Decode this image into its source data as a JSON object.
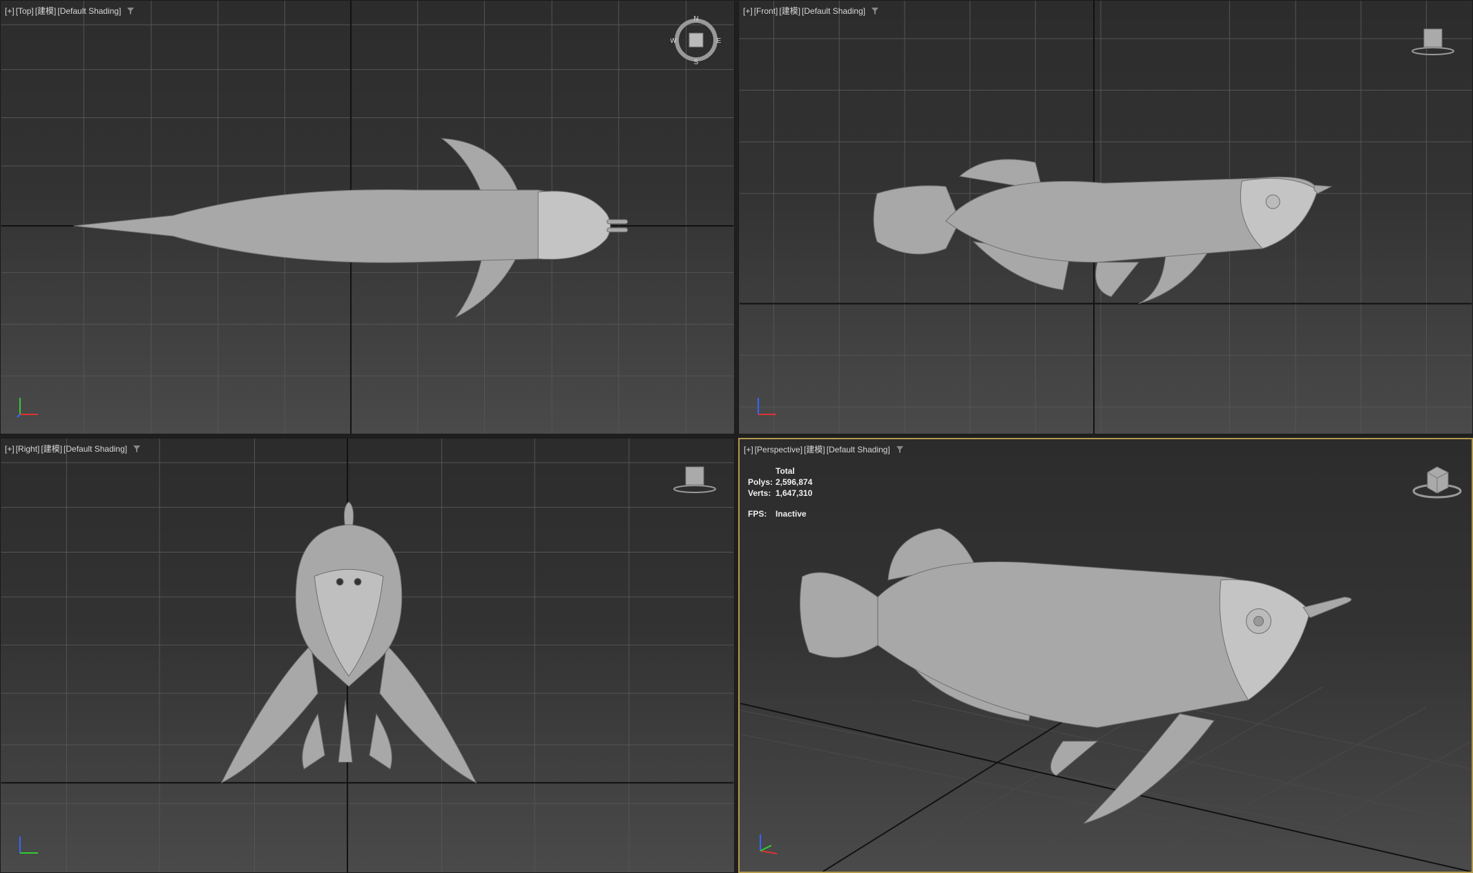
{
  "viewports": {
    "top": {
      "plus": "[+]",
      "view": "[Top]",
      "mode": "[建模]",
      "shading": "[Default Shading]"
    },
    "front": {
      "plus": "[+]",
      "view": "[Front]",
      "mode": "[建模]",
      "shading": "[Default Shading]"
    },
    "right": {
      "plus": "[+]",
      "view": "[Right]",
      "mode": "[建模]",
      "shading": "[Default Shading]"
    },
    "perspective": {
      "plus": "[+]",
      "view": "[Perspective]",
      "mode": "[建模]",
      "shading": "[Default Shading]",
      "stats": {
        "total_label": "Total",
        "polys_label": "Polys:",
        "polys_value": "2,596,874",
        "verts_label": "Verts:",
        "verts_value": "1,647,310",
        "fps_label": "FPS:",
        "fps_value": "Inactive"
      }
    }
  },
  "compass": {
    "n": "N",
    "s": "S",
    "e": "E",
    "w": "W"
  },
  "colors": {
    "active_border": "#b59a4c",
    "grid": "#5a5a5a",
    "axis_x": "#d33",
    "axis_y": "#3c3",
    "axis_z": "#36f",
    "model": "#a9a9a9"
  },
  "icons": {
    "filter": "filter-icon",
    "viewcube": "viewcube-icon",
    "axis": "axis-tripod-icon"
  }
}
